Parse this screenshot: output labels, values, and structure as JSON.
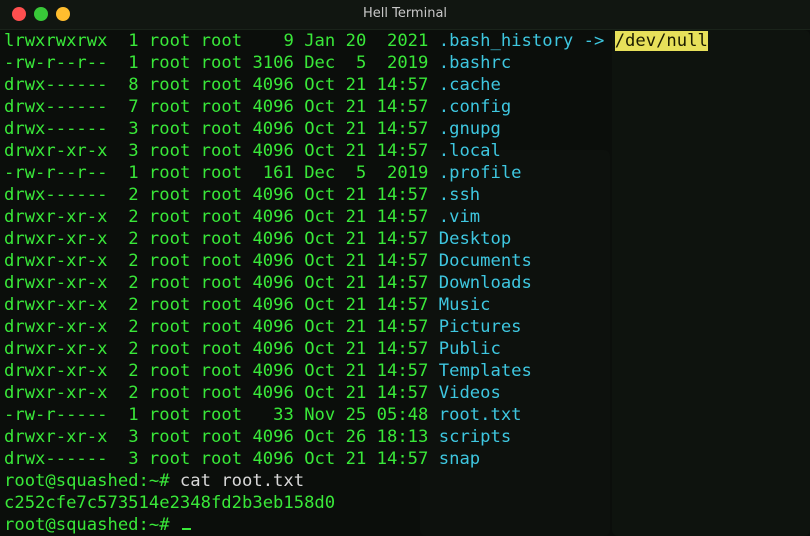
{
  "window": {
    "title": "Hell Terminal"
  },
  "listing": [
    {
      "perms": "lrwxrwxrwx",
      "links": "1",
      "owner": "root",
      "group": "root",
      "size": "9",
      "date": "Jan 20  2021",
      "name": ".bash_history",
      "link_arrow": " -> ",
      "link_target": "/dev/null"
    },
    {
      "perms": "-rw-r--r--",
      "links": "1",
      "owner": "root",
      "group": "root",
      "size": "3106",
      "date": "Dec  5  2019",
      "name": ".bashrc"
    },
    {
      "perms": "drwx------",
      "links": "8",
      "owner": "root",
      "group": "root",
      "size": "4096",
      "date": "Oct 21 14:57",
      "name": ".cache"
    },
    {
      "perms": "drwx------",
      "links": "7",
      "owner": "root",
      "group": "root",
      "size": "4096",
      "date": "Oct 21 14:57",
      "name": ".config"
    },
    {
      "perms": "drwx------",
      "links": "3",
      "owner": "root",
      "group": "root",
      "size": "4096",
      "date": "Oct 21 14:57",
      "name": ".gnupg"
    },
    {
      "perms": "drwxr-xr-x",
      "links": "3",
      "owner": "root",
      "group": "root",
      "size": "4096",
      "date": "Oct 21 14:57",
      "name": ".local"
    },
    {
      "perms": "-rw-r--r--",
      "links": "1",
      "owner": "root",
      "group": "root",
      "size": "161",
      "date": "Dec  5  2019",
      "name": ".profile"
    },
    {
      "perms": "drwx------",
      "links": "2",
      "owner": "root",
      "group": "root",
      "size": "4096",
      "date": "Oct 21 14:57",
      "name": ".ssh"
    },
    {
      "perms": "drwxr-xr-x",
      "links": "2",
      "owner": "root",
      "group": "root",
      "size": "4096",
      "date": "Oct 21 14:57",
      "name": ".vim"
    },
    {
      "perms": "drwxr-xr-x",
      "links": "2",
      "owner": "root",
      "group": "root",
      "size": "4096",
      "date": "Oct 21 14:57",
      "name": "Desktop"
    },
    {
      "perms": "drwxr-xr-x",
      "links": "2",
      "owner": "root",
      "group": "root",
      "size": "4096",
      "date": "Oct 21 14:57",
      "name": "Documents"
    },
    {
      "perms": "drwxr-xr-x",
      "links": "2",
      "owner": "root",
      "group": "root",
      "size": "4096",
      "date": "Oct 21 14:57",
      "name": "Downloads"
    },
    {
      "perms": "drwxr-xr-x",
      "links": "2",
      "owner": "root",
      "group": "root",
      "size": "4096",
      "date": "Oct 21 14:57",
      "name": "Music"
    },
    {
      "perms": "drwxr-xr-x",
      "links": "2",
      "owner": "root",
      "group": "root",
      "size": "4096",
      "date": "Oct 21 14:57",
      "name": "Pictures"
    },
    {
      "perms": "drwxr-xr-x",
      "links": "2",
      "owner": "root",
      "group": "root",
      "size": "4096",
      "date": "Oct 21 14:57",
      "name": "Public"
    },
    {
      "perms": "drwxr-xr-x",
      "links": "2",
      "owner": "root",
      "group": "root",
      "size": "4096",
      "date": "Oct 21 14:57",
      "name": "Templates"
    },
    {
      "perms": "drwxr-xr-x",
      "links": "2",
      "owner": "root",
      "group": "root",
      "size": "4096",
      "date": "Oct 21 14:57",
      "name": "Videos"
    },
    {
      "perms": "-rw-r-----",
      "links": "1",
      "owner": "root",
      "group": "root",
      "size": "33",
      "date": "Nov 25 05:48",
      "name": "root.txt"
    },
    {
      "perms": "drwxr-xr-x",
      "links": "3",
      "owner": "root",
      "group": "root",
      "size": "4096",
      "date": "Oct 26 18:13",
      "name": "scripts"
    },
    {
      "perms": "drwx------",
      "links": "3",
      "owner": "root",
      "group": "root",
      "size": "4096",
      "date": "Oct 21 14:57",
      "name": "snap"
    }
  ],
  "commands": {
    "prompt": "root@squashed:~#",
    "cmd1": " cat root.txt",
    "output1": "c252cfe7c573514e2348fd2b3eb158d0",
    "cmd2": " "
  },
  "colors": {
    "green": "#39e839",
    "cyan": "#3ec7e0",
    "highlight": "#e7e05a",
    "background": "#0b0e0b"
  }
}
